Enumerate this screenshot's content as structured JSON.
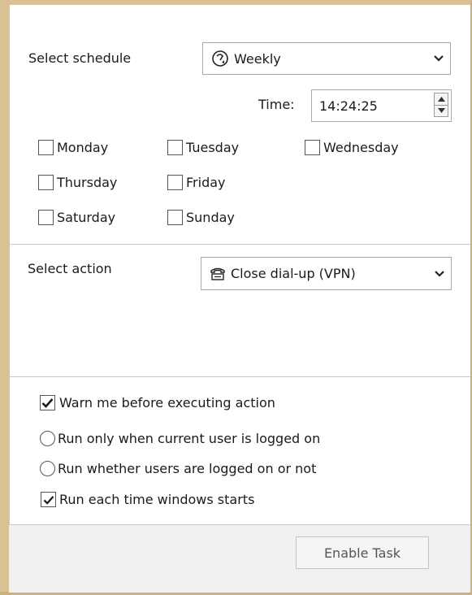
{
  "schedule": {
    "label": "Select schedule",
    "selected": "Weekly",
    "icon": "recurring-clock-icon",
    "time_label": "Time:",
    "time_value": "14:24:25",
    "days": [
      {
        "label": "Monday",
        "checked": false
      },
      {
        "label": "Tuesday",
        "checked": false
      },
      {
        "label": "Wednesday",
        "checked": false
      },
      {
        "label": "Thursday",
        "checked": false
      },
      {
        "label": "Friday",
        "checked": false
      },
      {
        "label": "Saturday",
        "checked": false
      },
      {
        "label": "Sunday",
        "checked": false
      }
    ]
  },
  "action": {
    "label": "Select action",
    "selected": "Close dial-up (VPN)",
    "icon": "telephone-icon"
  },
  "options": {
    "warn": {
      "label": "Warn me before executing action",
      "checked": true
    },
    "run_logged_on": {
      "label": "Run only when current user is logged on",
      "selected": false
    },
    "run_whether": {
      "label": "Run whether users are logged on or not",
      "selected": false
    },
    "run_each_start": {
      "label": "Run each time windows starts",
      "checked": true
    }
  },
  "footer": {
    "enable_button": "Enable Task"
  },
  "colors": {
    "frame": "#d8c294",
    "footer_bg": "#f0f0f0",
    "check": "#1a1a1a"
  }
}
